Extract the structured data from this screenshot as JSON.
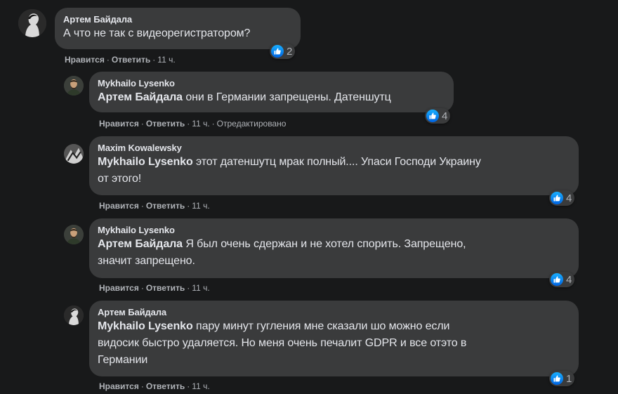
{
  "labels": {
    "like": "Нравится",
    "reply": "Ответить",
    "separator": "·"
  },
  "comments": [
    {
      "author": "Артем Байдала",
      "text": "А что не так с видеорегистратором?",
      "time": "11 ч.",
      "likes": "2"
    },
    {
      "author": "Mykhailo Lysenko",
      "mention": "Артем Байдала",
      "text": "они в Германии запрещены. Датеншутц",
      "time": "11 ч.",
      "edited": "Отредактировано",
      "likes": "4"
    },
    {
      "author": "Maxim Kowalewsky",
      "mention": "Mykhailo Lysenko",
      "text": "этот датеншутц мрак полный.... Упаси Господи Украину",
      "text2": "от этого!",
      "time": "11 ч.",
      "likes": "4"
    },
    {
      "author": "Mykhailo Lysenko",
      "mention": "Артем Байдала",
      "text": "Я был очень сдержан и не хотел спорить. Запрещено,",
      "text2": "значит запрещено.",
      "time": "11 ч.",
      "likes": "4"
    },
    {
      "author": "Артем Байдала",
      "mention": "Mykhailo Lysenko",
      "text": "пару минут гугления мне сказали шо можно если",
      "text2": "видосик быстро удаляется. Но меня очень печалит GDPR и все отэто в",
      "text3": "Германии",
      "time": "11 ч.",
      "likes": "1"
    }
  ]
}
